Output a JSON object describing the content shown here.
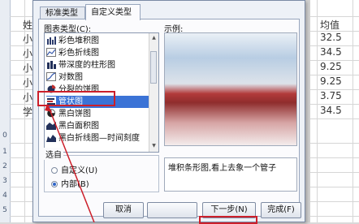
{
  "spreadsheet": {
    "row_numbers": [
      "0",
      "1",
      "2",
      "3",
      "4",
      "5"
    ],
    "col_left_cells": [
      "姓",
      "小",
      "小",
      "小",
      "小",
      "小",
      "学"
    ],
    "col_right_header": "均值",
    "col_right_values": [
      "32.5",
      "34.5",
      "9.25",
      "9.25",
      "3.75",
      "34.5"
    ]
  },
  "dialog": {
    "tabs": [
      "标准类型",
      "自定义类型"
    ],
    "active_tab": "自定义类型",
    "chart_type_label": "图表类型(C):",
    "chart_types": [
      {
        "label": "彩色堆积图",
        "icon": "stacked-color-icon"
      },
      {
        "label": "彩色折线图",
        "icon": "color-line-icon"
      },
      {
        "label": "带深度的柱形图",
        "icon": "column-depth-icon"
      },
      {
        "label": "对数图",
        "icon": "log-chart-icon"
      },
      {
        "label": "分裂的饼图",
        "icon": "exploded-pie-icon"
      },
      {
        "label": "管状图",
        "icon": "tube-chart-icon"
      },
      {
        "label": "黑白饼图",
        "icon": "bw-pie-icon"
      },
      {
        "label": "黑白面积图",
        "icon": "bw-area-icon"
      },
      {
        "label": "黑白折线图—时间刻度",
        "icon": "bw-line-time-icon"
      }
    ],
    "selected_type": "管状图",
    "preview_label": "示例:",
    "source_label": "选自",
    "source_options": [
      "自定义(U)",
      "内部(B)"
    ],
    "source_selected": "内部(B)",
    "description": "堆积条形图,看上去象一个管子",
    "buttons": [
      "取消",
      "",
      "下一步(N)",
      "完成(F)"
    ],
    "highlight_color": "#cc1f2a"
  }
}
